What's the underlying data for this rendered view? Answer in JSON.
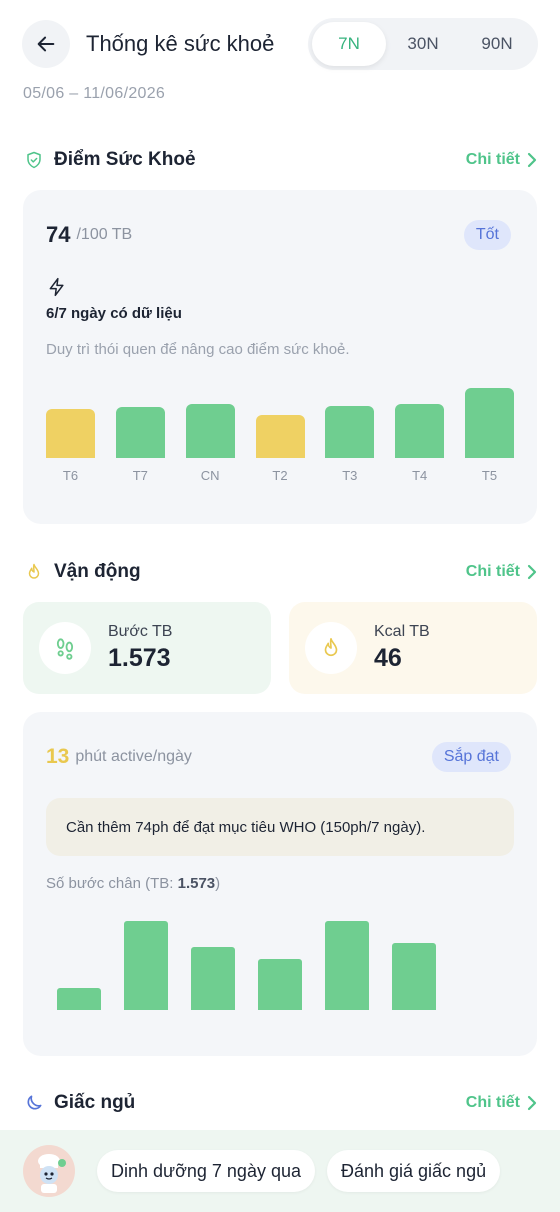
{
  "header": {
    "title": "Thống kê sức khoẻ",
    "back_icon": "arrow-left-icon",
    "range_tabs": [
      "7N",
      "30N",
      "90N"
    ],
    "active_tab": "7N"
  },
  "date_range": "05/06 – 11/06/2026",
  "health": {
    "section_title": "Điểm Sức Khoẻ",
    "detail_label": "Chi tiết",
    "score": "74",
    "score_unit": "/100 TB",
    "badge": "Tốt",
    "data_days": "6/7 ngày có dữ liệu",
    "hint": "Duy trì thói quen để nâng cao điểm sức khoẻ.",
    "chart_data": {
      "type": "bar",
      "categories": [
        "T6",
        "T7",
        "CN",
        "T2",
        "T3",
        "T4",
        "T5"
      ],
      "values": [
        70,
        73,
        77,
        62,
        75,
        77,
        100
      ],
      "colors": [
        "#efd163",
        "#6fce90",
        "#6fce90",
        "#efd163",
        "#6fce90",
        "#6fce90",
        "#6fce90"
      ]
    }
  },
  "activity": {
    "section_title": "Vận động",
    "detail_label": "Chi tiết",
    "steps_label": "Bước TB",
    "steps_value": "1.573",
    "kcal_label": "Kcal TB",
    "kcal_value": "46",
    "active_minutes": "13",
    "active_unit": "phút active/ngày",
    "badge": "Sắp đạt",
    "note": "Cần thêm 74ph để đạt mục tiêu WHO (150ph/7 ngày).",
    "steps_caption_prefix": "Số bước chân (TB: ",
    "steps_caption_value": "1.573",
    "steps_caption_suffix": ")",
    "chart_data": {
      "type": "bar",
      "values": [
        560,
        2270,
        1620,
        1290,
        2270,
        1720
      ],
      "colors": [
        "#6fce90",
        "#6fce90",
        "#6fce90",
        "#6fce90",
        "#6fce90",
        "#6fce90"
      ]
    }
  },
  "sleep": {
    "section_title": "Giấc ngủ",
    "detail_label": "Chi tiết"
  },
  "bottom": {
    "chip_1": "Dinh dưỡng 7 ngày qua",
    "chip_2": "Đánh giá giấc ngủ"
  }
}
